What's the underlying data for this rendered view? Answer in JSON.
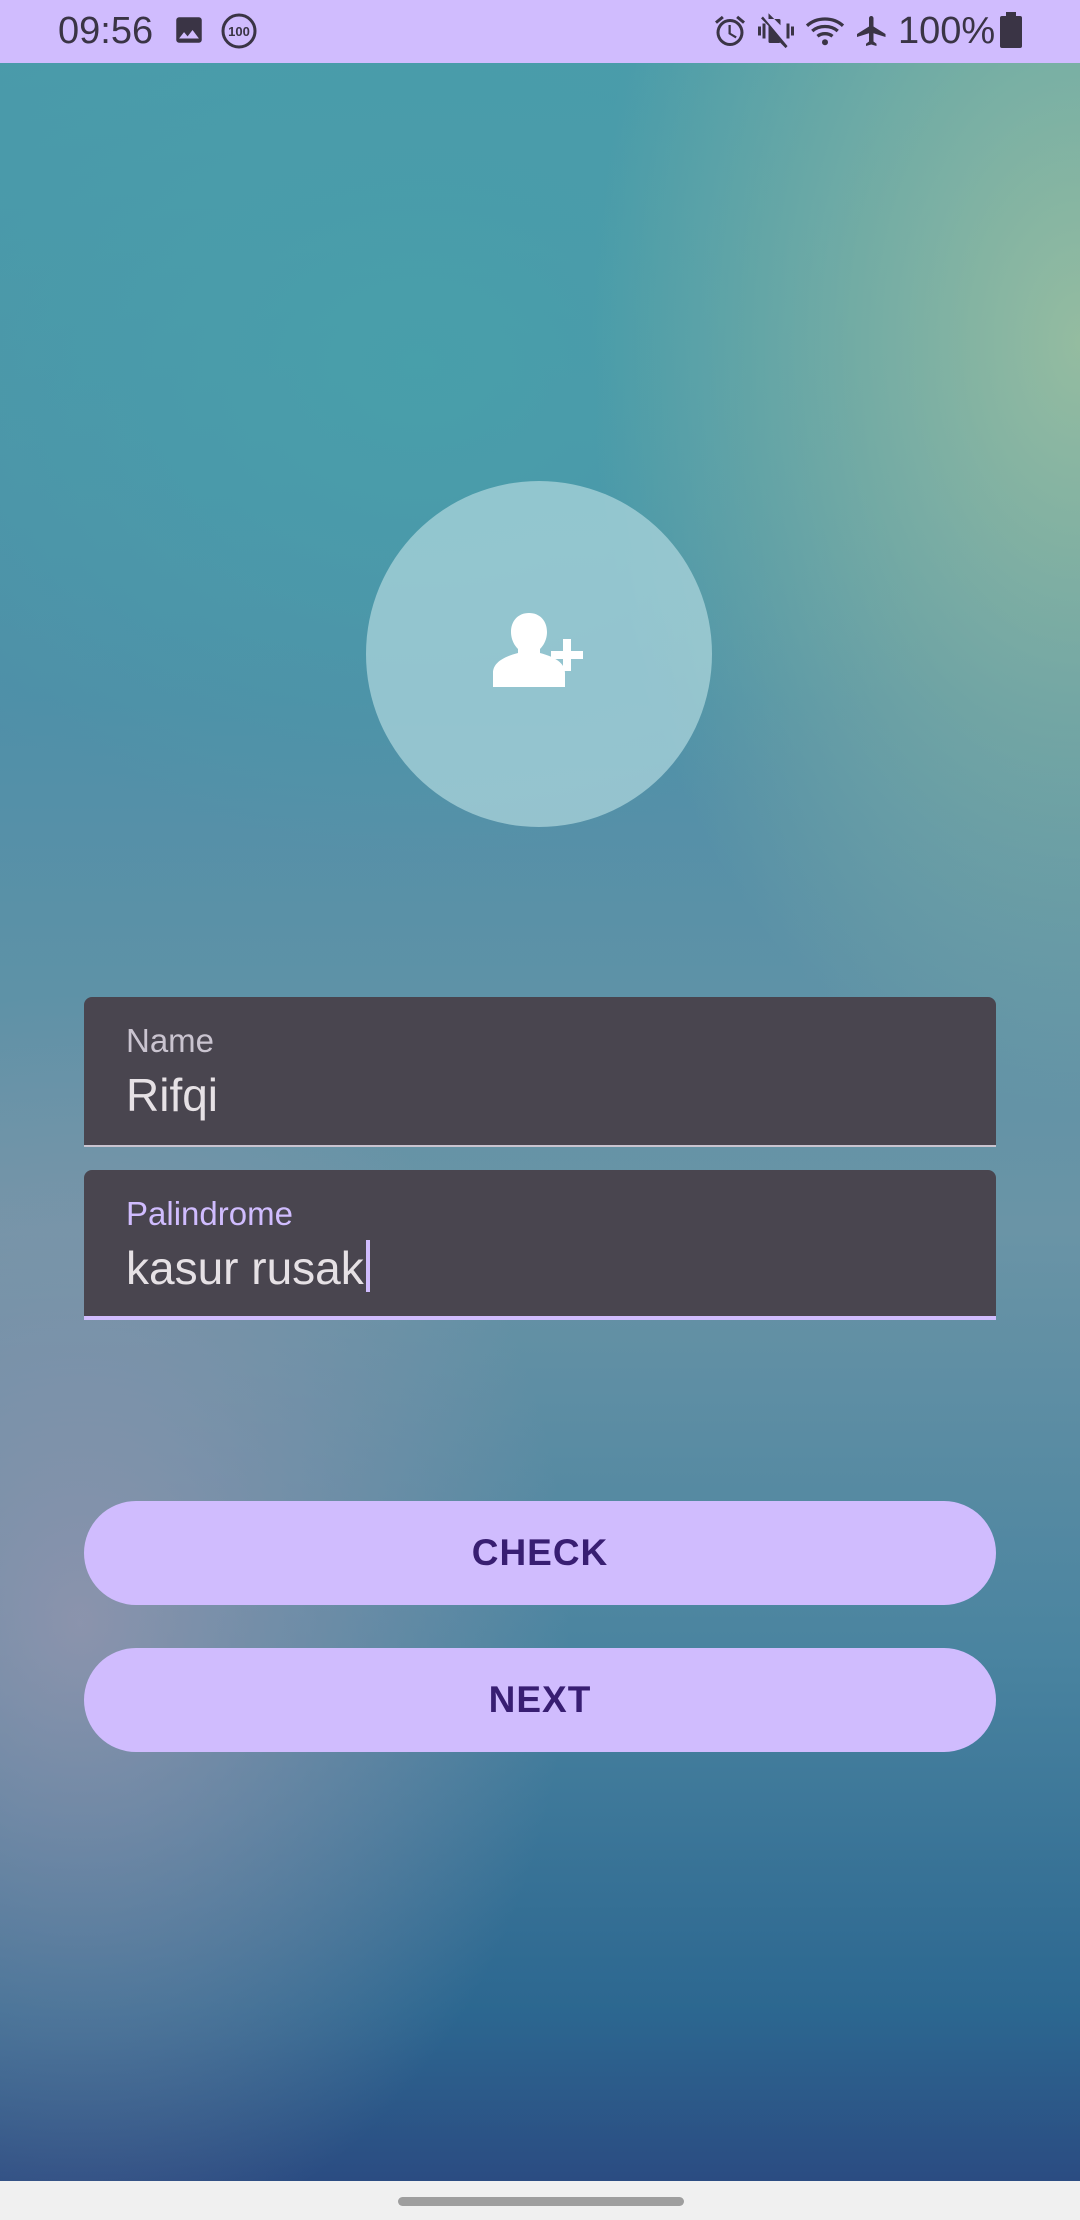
{
  "status_bar": {
    "time": "09:56",
    "battery": "100%",
    "icons": [
      "image-icon",
      "badge-100-icon",
      "alarm-icon",
      "vibrate-mute-icon",
      "wifi-icon",
      "airplane-icon",
      "battery-full-icon"
    ],
    "badge_text": "100",
    "background_color": "#d0bcfe"
  },
  "avatar": {
    "icon": "add-person-icon"
  },
  "form": {
    "name": {
      "label": "Name",
      "value": "Rifqi"
    },
    "palindrome": {
      "label": "Palindrome",
      "value": "kasur rusak",
      "focused": true
    }
  },
  "buttons": {
    "check_label": "CHECK",
    "next_label": "NEXT"
  },
  "colors": {
    "accent": "#d0bcfe",
    "button_text": "#381e72",
    "field_background": "#49454f"
  }
}
